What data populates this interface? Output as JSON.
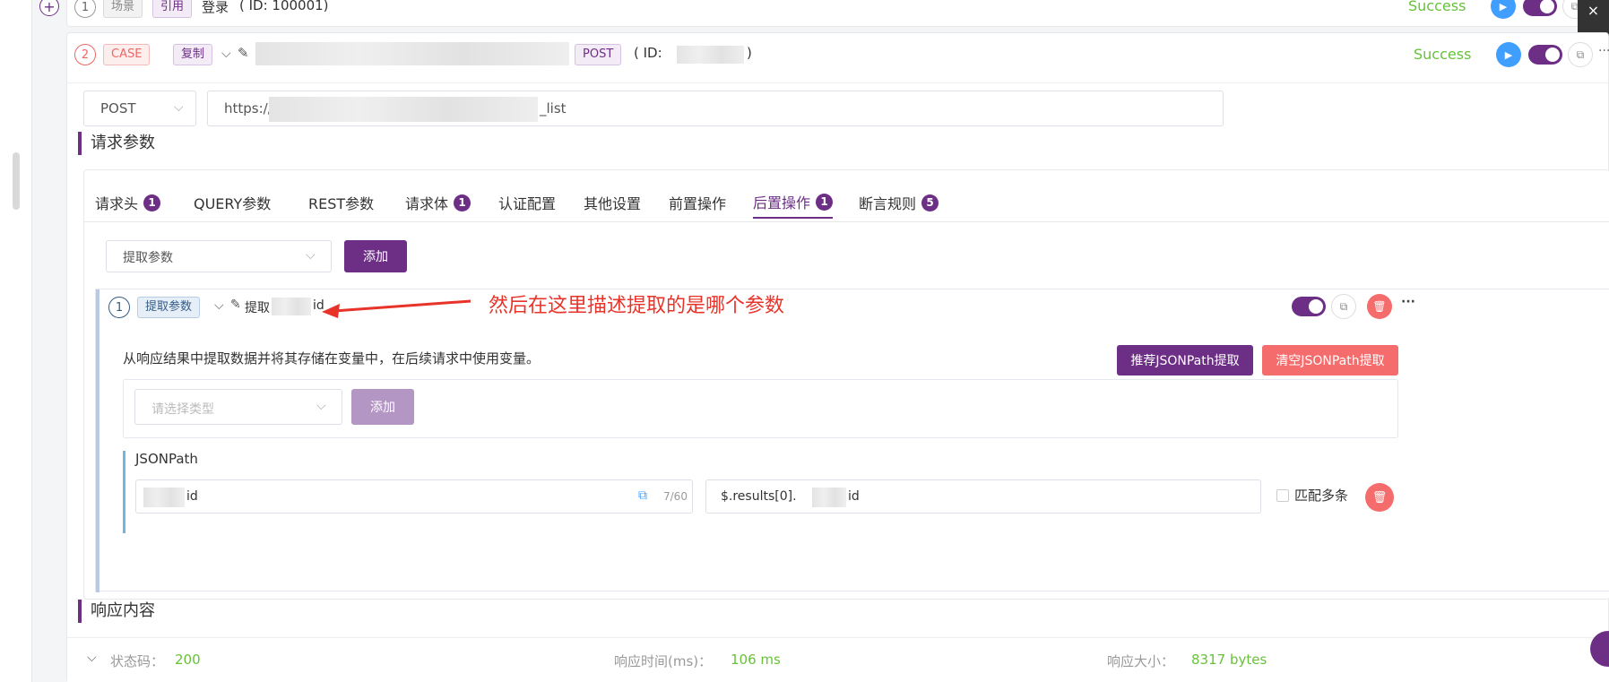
{
  "scene_row": {
    "index": "1",
    "type_tag": "场景",
    "ref_tag": "引用",
    "name": "登录",
    "id_text": "( ID: 100001)",
    "status": "Success"
  },
  "case_row": {
    "index": "2",
    "type_tag": "CASE",
    "copy_tag": "复制",
    "method_tag": "POST",
    "id_prefix": "( ID:",
    "id_suffix": ")",
    "status": "Success"
  },
  "request": {
    "method": "POST",
    "url_prefix": "https://",
    "url_suffix": "_list"
  },
  "section_request": "请求参数",
  "tabs": [
    {
      "label": "请求头",
      "badge": "1"
    },
    {
      "label": "QUERY参数",
      "badge": ""
    },
    {
      "label": "REST参数",
      "badge": ""
    },
    {
      "label": "请求体",
      "badge": "1"
    },
    {
      "label": "认证配置",
      "badge": ""
    },
    {
      "label": "其他设置",
      "badge": ""
    },
    {
      "label": "前置操作",
      "badge": ""
    },
    {
      "label": "后置操作",
      "badge": "1"
    },
    {
      "label": "断言规则",
      "badge": "5"
    }
  ],
  "post_op": {
    "select_value": "提取参数",
    "add_label": "添加"
  },
  "extract_item": {
    "index": "1",
    "type_tag": "提取参数",
    "name_prefix": "提取",
    "name_suffix": "id",
    "annotation": "然后在这里描述提取的是哪个参数",
    "description": "从响应结果中提取数据并将其存储在变量中，在后续请求中使用变量。",
    "recommend_btn": "推荐JSONPath提取",
    "clear_btn": "清空JSONPath提取",
    "type_placeholder": "请选择类型",
    "add_label": "添加",
    "jsonpath_label": "JSONPath",
    "var_suffix": "id",
    "char_count": "7/60",
    "path_prefix": "$.results[0].",
    "path_suffix": "id",
    "match_multiple": "匹配多条"
  },
  "section_response": "响应内容",
  "response": {
    "status_label": "状态码：",
    "status_value": "200",
    "time_label": "响应时间(ms)：",
    "time_value": "106 ms",
    "size_label": "响应大小：",
    "size_value": "8317 bytes"
  },
  "colors": {
    "primary": "#6d2e86",
    "success": "#67c23a",
    "danger": "#f56c6c",
    "annotation": "#e8332a"
  }
}
